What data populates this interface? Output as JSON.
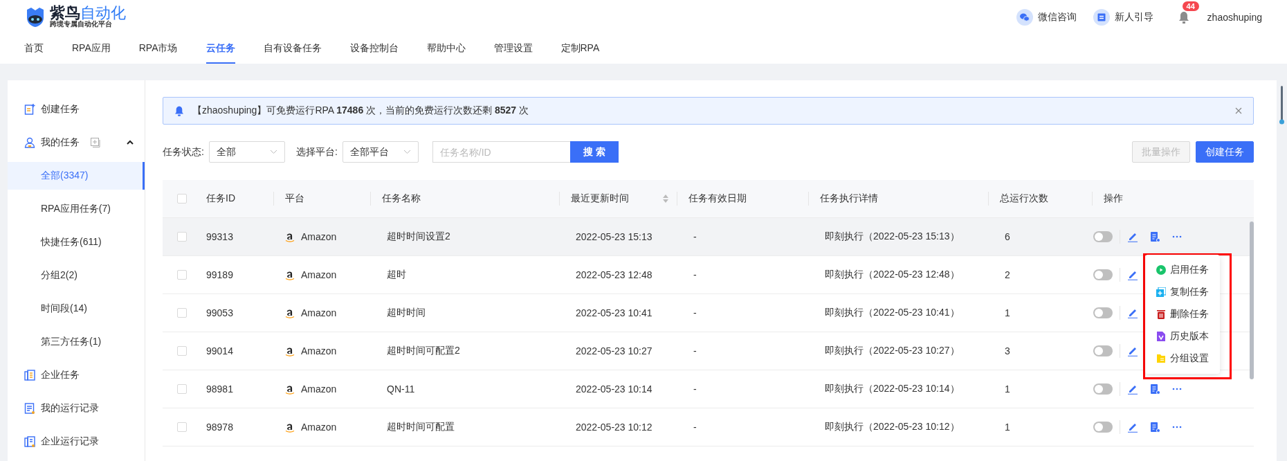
{
  "logo": {
    "title": "紫鸟",
    "title_accent": "自动化",
    "subtitle": "跨境专属自动化平台"
  },
  "header_actions": [
    {
      "kind": "wechat",
      "label": "微信咨询"
    },
    {
      "kind": "guide",
      "label": "新人引导"
    }
  ],
  "notifications": {
    "count": "44"
  },
  "user": {
    "name": "zhaoshuping"
  },
  "nav": [
    {
      "label": "首页",
      "selected": false
    },
    {
      "label": "RPA应用",
      "selected": false
    },
    {
      "label": "RPA市场",
      "selected": false
    },
    {
      "label": "云任务",
      "selected": true
    },
    {
      "label": "自有设备任务",
      "selected": false
    },
    {
      "label": "设备控制台",
      "selected": false
    },
    {
      "label": "帮助中心",
      "selected": false
    },
    {
      "label": "管理设置",
      "selected": false
    },
    {
      "label": "定制RPA",
      "selected": false
    }
  ],
  "sidebar": {
    "items": [
      {
        "kind": "create",
        "label": "创建任务"
      },
      {
        "kind": "mine",
        "label": "我的任务",
        "expanded": true,
        "children": [
          {
            "label": "全部(3347)",
            "selected": true
          },
          {
            "label": "RPA应用任务(7)",
            "selected": false
          },
          {
            "label": "快捷任务(611)",
            "selected": false
          },
          {
            "label": "分组2(2)",
            "selected": false
          },
          {
            "label": "时间段(14)",
            "selected": false
          },
          {
            "label": "第三方任务(1)",
            "selected": false
          }
        ]
      },
      {
        "kind": "enterprise",
        "label": "企业任务"
      },
      {
        "kind": "records",
        "label": "我的运行记录"
      },
      {
        "kind": "enterprise_records",
        "label": "企业运行记录"
      }
    ]
  },
  "notice": {
    "text": "【zhaoshuping】可免费运行RPA **17486** 次，当前的免费运行次数还剩 **8527** 次"
  },
  "filters": [
    {
      "label": "任务状态:",
      "value": "全部"
    },
    {
      "label": "选择平台:",
      "value": "全部平台"
    }
  ],
  "search": {
    "placeholder": "任务名称/ID",
    "button": "搜 索"
  },
  "toolbar_buttons": [
    {
      "label": "批量操作",
      "disabled": true
    },
    {
      "label": "创建任务",
      "disabled": false
    }
  ],
  "table": {
    "header_checked": false,
    "columns": [
      "任务ID",
      "平台",
      "任务名称",
      "最近更新时间",
      "任务有效日期",
      "任务执行详情",
      "总运行次数",
      "操作"
    ],
    "rows": [
      {
        "id": "99313",
        "platform": "Amazon",
        "name": "超时时间设置2",
        "updated": "2022-05-23 15:13",
        "valid": "-",
        "detail": "即刻执行（2022-05-23 15:13）",
        "runs": "6",
        "checked": false,
        "enabled": false,
        "highlighted": true
      },
      {
        "id": "99189",
        "platform": "Amazon",
        "name": "超时",
        "updated": "2022-05-23 12:48",
        "valid": "-",
        "detail": "即刻执行（2022-05-23 12:48）",
        "runs": "2",
        "checked": false,
        "enabled": false,
        "highlighted": false,
        "actions_covered": true
      },
      {
        "id": "99053",
        "platform": "Amazon",
        "name": "超时时间",
        "updated": "2022-05-23 10:41",
        "valid": "-",
        "detail": "即刻执行（2022-05-23 10:41）",
        "runs": "1",
        "checked": false,
        "enabled": false,
        "highlighted": false,
        "actions_covered": true
      },
      {
        "id": "99014",
        "platform": "Amazon",
        "name": "超时时间可配置2",
        "updated": "2022-05-23 10:27",
        "valid": "-",
        "detail": "即刻执行（2022-05-23 10:27）",
        "runs": "3",
        "checked": false,
        "enabled": false,
        "highlighted": false,
        "actions_covered": true
      },
      {
        "id": "98981",
        "platform": "Amazon",
        "name": "QN-11",
        "updated": "2022-05-23 10:14",
        "valid": "-",
        "detail": "即刻执行（2022-05-23 10:14）",
        "runs": "1",
        "checked": false,
        "enabled": false,
        "highlighted": false
      },
      {
        "id": "98978",
        "platform": "Amazon",
        "name": "超时时间可配置",
        "updated": "2022-05-23 10:12",
        "valid": "-",
        "detail": "即刻执行（2022-05-23 10:12）",
        "runs": "1",
        "checked": false,
        "enabled": false,
        "highlighted": false
      }
    ]
  },
  "row_menu": {
    "items": [
      {
        "kind": "start",
        "label": "启用任务"
      },
      {
        "kind": "copy",
        "label": "复制任务"
      },
      {
        "kind": "delete",
        "label": "删除任务"
      },
      {
        "kind": "history",
        "label": "历史版本"
      },
      {
        "kind": "group",
        "label": "分组设置"
      }
    ]
  }
}
